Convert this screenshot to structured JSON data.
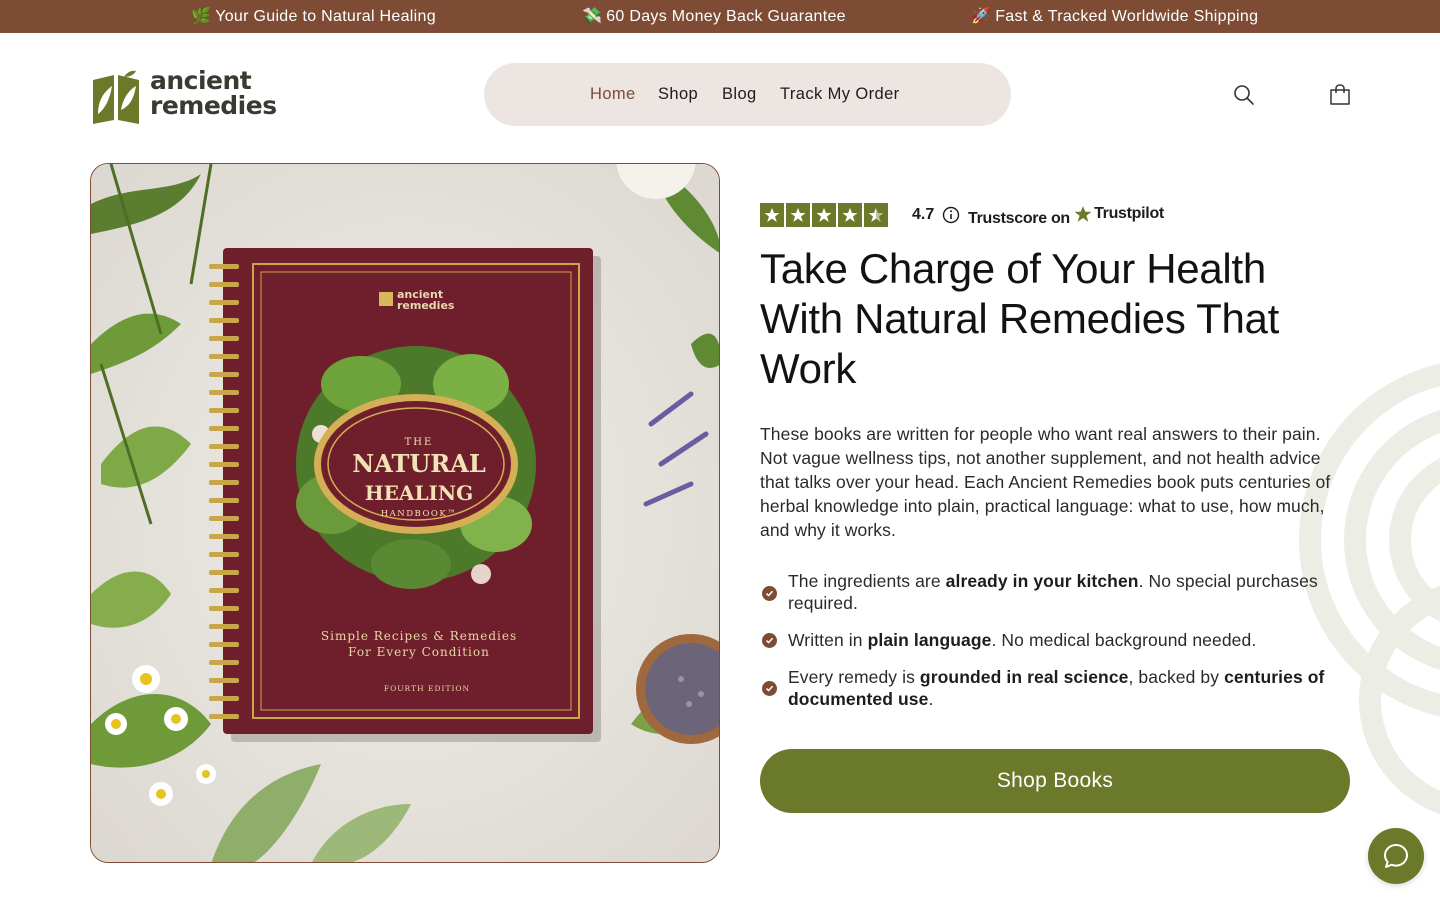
{
  "announcement": {
    "items": [
      {
        "emoji": "🌿",
        "text": "Your Guide to Natural Healing"
      },
      {
        "emoji": "💸",
        "text": "60 Days Money Back Guarantee"
      },
      {
        "emoji": "🚀",
        "text": "Fast & Tracked Worldwide Shipping"
      }
    ]
  },
  "header": {
    "logo": {
      "line1": "ancient",
      "line2": "remedies"
    },
    "nav": [
      "Home",
      "Shop",
      "Blog",
      "Track My Order"
    ],
    "active_nav": "Home",
    "icons": [
      "search-icon",
      "cart-icon"
    ]
  },
  "hero": {
    "book": {
      "brand_line1": "ancient",
      "brand_line2": "remedies",
      "the": "THE",
      "title_line1": "NATURAL",
      "title_line2": "HEALING",
      "handbook": "HANDBOOK™",
      "tagline_line1": "Simple Recipes & Remedies",
      "tagline_line2": "For Every Condition",
      "edition": "FOURTH EDITION"
    },
    "rating": {
      "stars": 4.5,
      "score": "4.7",
      "trustscore_label": "Trustscore on",
      "platform": "Trustpilot"
    },
    "title": "Take Charge of Your Health With Natural Remedies That Work",
    "description": "These books are written for people who want real answers to their pain. Not vague wellness tips, not another supplement, and not health advice that talks over your head. Each Ancient Remedies book puts centuries of herbal knowledge into plain, practical language: what to use, how much, and why it works.",
    "benefits": [
      {
        "parts": [
          {
            "t": "The ingredients are "
          },
          {
            "t": "already in your kitchen",
            "b": true
          },
          {
            "t": ". No special purchases required."
          }
        ]
      },
      {
        "parts": [
          {
            "t": "Written in "
          },
          {
            "t": "plain language",
            "b": true
          },
          {
            "t": ". No medical background needed."
          }
        ]
      },
      {
        "parts": [
          {
            "t": "Every remedy is "
          },
          {
            "t": "grounded in real science",
            "b": true
          },
          {
            "t": ", backed by "
          },
          {
            "t": "centuries of documented use",
            "b": true
          },
          {
            "t": "."
          }
        ]
      }
    ],
    "cta": "Shop Books"
  },
  "colors": {
    "announcement_bg": "#7e4c35",
    "accent_green": "#6b7a2a",
    "nav_pill_bg": "#ece5e1",
    "book_maroon": "#6e1f2b",
    "check_brown": "#7e4c35"
  }
}
